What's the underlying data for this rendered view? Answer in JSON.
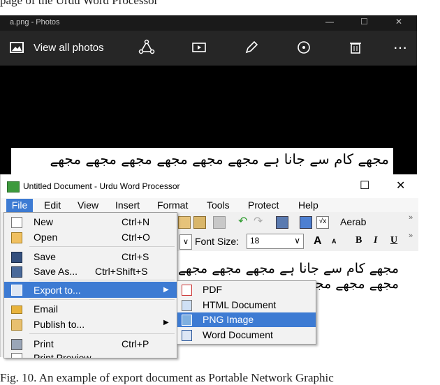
{
  "top_caption": "page of the Urdu Word Processor",
  "photos": {
    "title": "a.png - Photos",
    "view_all_label": "View all photos",
    "image_text": "مجھے کام سے جانا ہے مجھے مجھے مجھے مجھے مجھے مجھے"
  },
  "uwp": {
    "title": "Untitled Document - Urdu Word Processor",
    "menu": [
      "File",
      "Edit",
      "View",
      "Insert",
      "Format",
      "Tools",
      "Protect",
      "Help"
    ],
    "font_size_label": "Font Size:",
    "font_size_value": "18",
    "aerab_label": "Aerab",
    "bold": "B",
    "italic": "I",
    "underline": "U",
    "font_a_big": "A",
    "font_a_small": "A",
    "doc_text": "مجھے کام سے جانا ہے مجھے مجھے مجھے مجھے مجھے مجھے"
  },
  "file_menu": {
    "new": {
      "label": "New",
      "shortcut": "Ctrl+N"
    },
    "open": {
      "label": "Open",
      "shortcut": "Ctrl+O"
    },
    "save": {
      "label": "Save",
      "shortcut": "Ctrl+S"
    },
    "save_as": {
      "label": "Save As...",
      "shortcut": "Ctrl+Shift+S"
    },
    "export": {
      "label": "Export to..."
    },
    "email": {
      "label": "Email"
    },
    "publish": {
      "label": "Publish to..."
    },
    "print": {
      "label": "Print",
      "shortcut": "Ctrl+P"
    },
    "print_preview": {
      "label": "Print Preview"
    }
  },
  "export_menu": [
    "PDF",
    "HTML Document",
    "PNG Image",
    "Word Document"
  ],
  "fig_caption": "Fig. 10. An example of export document as Portable Network Graphic"
}
